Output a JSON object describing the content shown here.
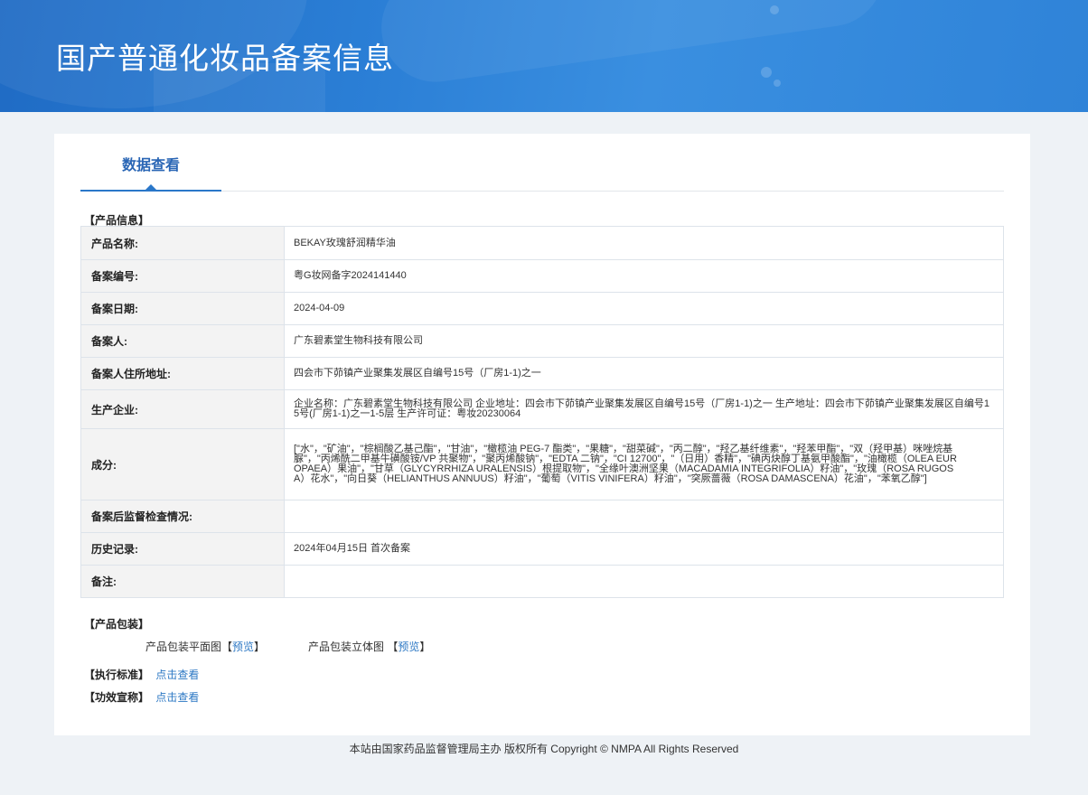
{
  "header": {
    "title": "国产普通化妆品备案信息"
  },
  "tabs": [
    {
      "label": "数据查看"
    }
  ],
  "product_info": {
    "section_title": "【产品信息】",
    "rows": [
      {
        "label": "产品名称:",
        "value": "BEKAY玫瑰舒润精华油"
      },
      {
        "label": "备案编号:",
        "value": "粤G妆网备字2024141440"
      },
      {
        "label": "备案日期:",
        "value": "2024-04-09"
      },
      {
        "label": "备案人:",
        "value": "广东碧素堂生物科技有限公司"
      },
      {
        "label": "备案人住所地址:",
        "value": "四会市下茆镇产业聚集发展区自编号15号（厂房1-1)之一"
      },
      {
        "label": "生产企业:",
        "value": "企业名称：广东碧素堂生物科技有限公司 企业地址：四会市下茆镇产业聚集发展区自编号15号（厂房1-1)之一 生产地址：四会市下茆镇产业聚集发展区自编号15号(厂房1-1)之一1-5层 生产许可证：粤妆20230064"
      },
      {
        "label": "成分:",
        "value": "[\"水\"，\"矿油\"，\"棕榈酸乙基己酯\"，\"甘油\"，\"橄榄油 PEG-7 酯类\"，\"果糖\"，\"甜菜碱\"，\"丙二醇\"，\"羟乙基纤维素\"，\"羟苯甲酯\"，\"双（羟甲基）咪唑烷基脲\"，\"丙烯酰二甲基牛磺酸铵/VP 共聚物\"，\"聚丙烯酸钠\"，\"EDTA 二钠\"，\"CI 12700\"，\"（日用）香精\"，\"碘丙炔醇丁基氨甲酸酯\"，\"油橄榄（OLEA EUROPAEA）果油\"，\"甘草（GLYCYRRHIZA URALENSIS）根提取物\"，\"全缘叶澳洲坚果（MACADAMIA INTEGRIFOLIA）籽油\"，\"玫瑰（ROSA RUGOSA）花水\"，\"向日葵（HELIANTHUS ANNUUS）籽油\"，\"葡萄（VITIS VINIFERA）籽油\"，\"突厥蔷薇（ROSA DAMASCENA）花油\"，\"苯氧乙醇\"]"
      },
      {
        "label": "备案后监督检查情况:",
        "value": ""
      },
      {
        "label": "历史记录:",
        "value": "2024年04月15日 首次备案"
      },
      {
        "label": "备注:",
        "value": ""
      }
    ]
  },
  "packaging": {
    "section_title": "【产品包装】",
    "flat_label": "产品包装平面图",
    "solid_label": "产品包装立体图",
    "bracket_open": "【",
    "bracket_close": "】",
    "preview_label": "预览"
  },
  "standard": {
    "section_title": "【执行标准】",
    "link": "点击查看"
  },
  "efficacy": {
    "section_title": "【功效宣称】",
    "link": "点击查看"
  },
  "footer": {
    "text": "本站由国家药品监督管理局主办 版权所有 Copyright © NMPA All Rights Reserved"
  },
  "colors": {
    "banner": "#2b7fd6",
    "link": "#2d78c4",
    "tab_accent": "#2a77c9"
  }
}
